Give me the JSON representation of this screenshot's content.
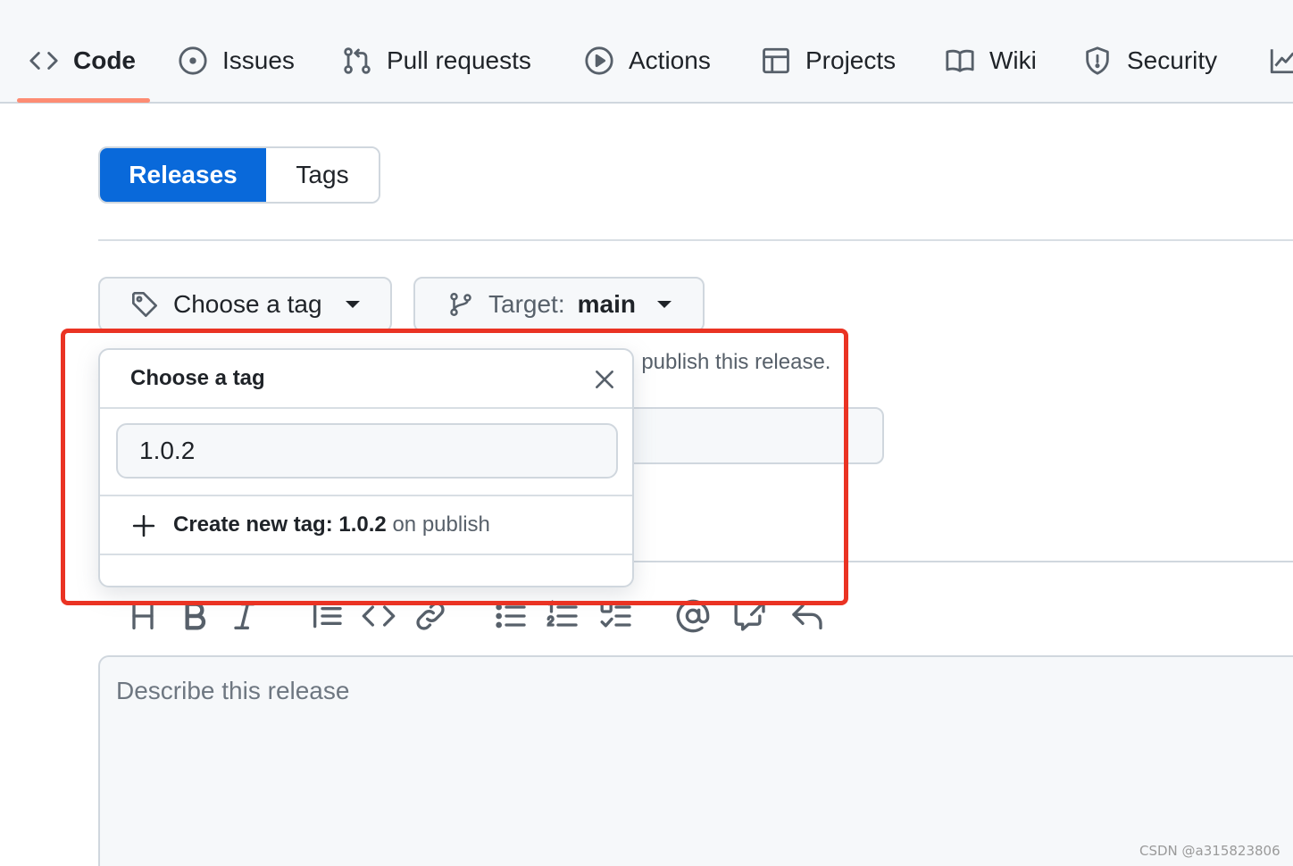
{
  "repo_nav": {
    "items": [
      {
        "label": "Code",
        "icon": "code-icon",
        "selected": true
      },
      {
        "label": "Issues",
        "icon": "issue-opened-icon"
      },
      {
        "label": "Pull requests",
        "icon": "git-pull-request-icon"
      },
      {
        "label": "Actions",
        "icon": "play-icon"
      },
      {
        "label": "Projects",
        "icon": "table-icon"
      },
      {
        "label": "Wiki",
        "icon": "book-icon"
      },
      {
        "label": "Security",
        "icon": "shield-icon"
      },
      {
        "label": "",
        "icon": "graph-icon"
      }
    ],
    "underline_color": "#fd8c73"
  },
  "segmented": {
    "releases_label": "Releases",
    "tags_label": "Tags",
    "active": "Releases",
    "accent": "#0969da"
  },
  "release_form": {
    "tag_button_label": "Choose a tag",
    "target_prefix": "Target:",
    "target_value": "main",
    "hint_fragment": "ı publish this release.",
    "description_placeholder": "Describe this release"
  },
  "tag_popover": {
    "title": "Choose a tag",
    "filter_value": "1.0.2",
    "create_prefix": "Create new tag:",
    "create_tag": "1.0.2",
    "create_suffix": "on publish"
  },
  "toolbar": {
    "tools": [
      "heading-icon",
      "bold-icon",
      "italic-icon",
      "quote-icon",
      "code-icon",
      "link-icon",
      "list-unordered-icon",
      "list-ordered-icon",
      "tasklist-icon",
      "mention-icon",
      "cross-reference-icon",
      "reply-icon"
    ]
  },
  "annotation": {
    "color": "#ea3323"
  },
  "watermark": "CSDN @a315823806"
}
